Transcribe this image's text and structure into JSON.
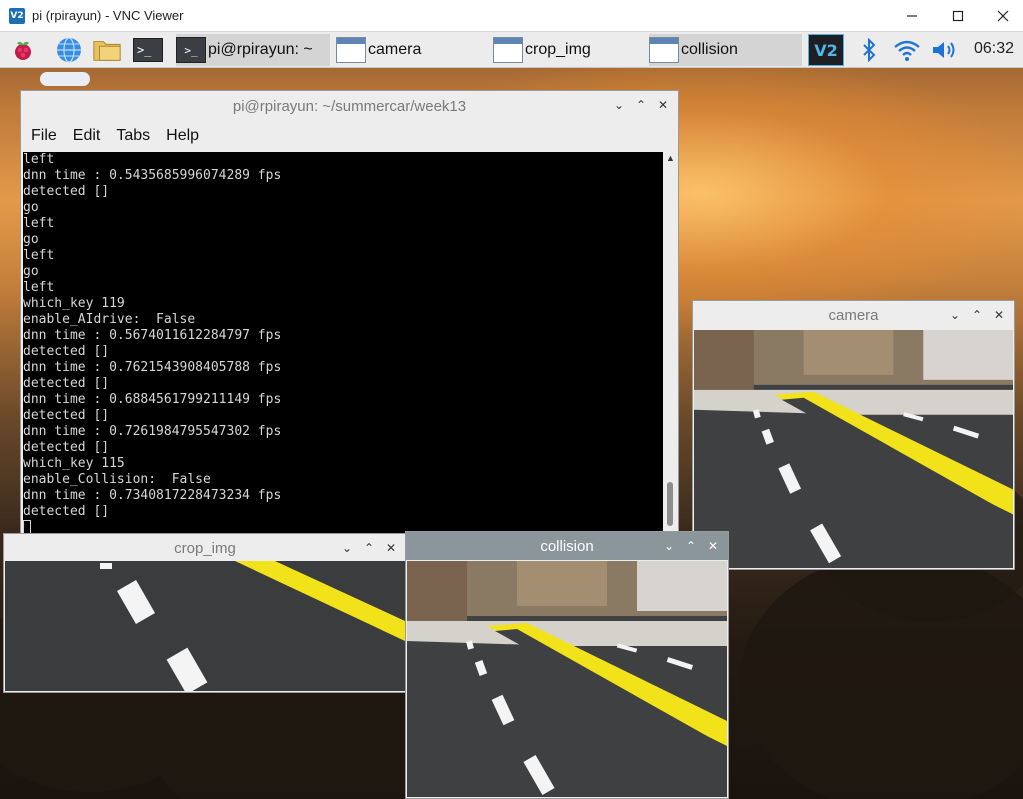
{
  "vnc": {
    "title": "pi (rpirayun) - VNC Viewer",
    "logo": "V2"
  },
  "taskbar": {
    "tasks": [
      {
        "label": "pi@rpirayun: ~",
        "icon": "terminal-icon"
      },
      {
        "label": "camera",
        "icon": "window-icon"
      },
      {
        "label": "crop_img",
        "icon": "window-icon"
      },
      {
        "label": "collision",
        "icon": "window-icon"
      }
    ],
    "tray_vnc": "V2",
    "clock": "06:32"
  },
  "terminal": {
    "title": "pi@rpirayun: ~/summercar/week13",
    "menu": [
      "File",
      "Edit",
      "Tabs",
      "Help"
    ],
    "lines": [
      "left",
      "dnn time : 0.5435685996074289 fps",
      "detected []",
      "go",
      "left",
      "go",
      "left",
      "go",
      "left",
      "which_key 119",
      "enable_AIdrive:  False",
      "dnn time : 0.5674011612284797 fps",
      "detected []",
      "dnn time : 0.7621543908405788 fps",
      "detected []",
      "dnn time : 0.6884561799211149 fps",
      "detected []",
      "dnn time : 0.7261984795547302 fps",
      "detected []",
      "which_key 115",
      "enable_Collision:  False",
      "dnn time : 0.7340817228473234 fps",
      "detected []"
    ]
  },
  "windows": {
    "camera": {
      "title": "camera"
    },
    "crop": {
      "title": "crop_img"
    },
    "collision": {
      "title": "collision"
    }
  },
  "colors": {
    "road": "#3e4042",
    "yellow_line": "#f2e21a",
    "white_dash": "#f4f4f4",
    "floor": "#cfcbc4"
  }
}
